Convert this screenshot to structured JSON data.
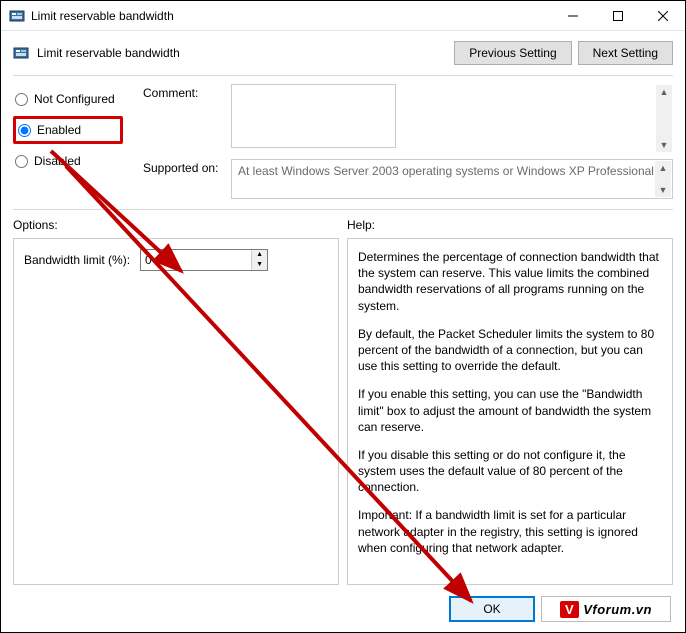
{
  "window": {
    "title": "Limit reservable bandwidth",
    "subtitle": "Limit reservable bandwidth"
  },
  "nav": {
    "previous": "Previous Setting",
    "next": "Next Setting"
  },
  "state": {
    "notConfigured": "Not Configured",
    "enabled": "Enabled",
    "disabled": "Disabled",
    "selected": "enabled"
  },
  "fields": {
    "commentLabel": "Comment:",
    "commentValue": "",
    "supportedLabel": "Supported on:",
    "supportedValue": "At least Windows Server 2003 operating systems or Windows XP Professional"
  },
  "sections": {
    "optionsLabel": "Options:",
    "helpLabel": "Help:"
  },
  "options": {
    "bandwidthLabel": "Bandwidth limit (%):",
    "bandwidthValue": "0"
  },
  "help": {
    "p1": "Determines the percentage of connection bandwidth that the system can reserve. This value limits the combined bandwidth reservations of all programs running on the system.",
    "p2": "By default, the Packet Scheduler limits the system to 80 percent of the bandwidth of a connection, but you can use this setting to override the default.",
    "p3": "If you enable this setting, you can use the \"Bandwidth limit\" box to adjust the amount of bandwidth the system can reserve.",
    "p4": "If you disable this setting or do not configure it, the system uses the default value of 80 percent of the connection.",
    "p5": "Important: If a bandwidth limit is set for a particular network adapter in the registry, this setting is ignored when configuring that network adapter."
  },
  "footer": {
    "ok": "OK"
  },
  "watermark": {
    "prefix": "V",
    "text": "Vforum.vn"
  }
}
